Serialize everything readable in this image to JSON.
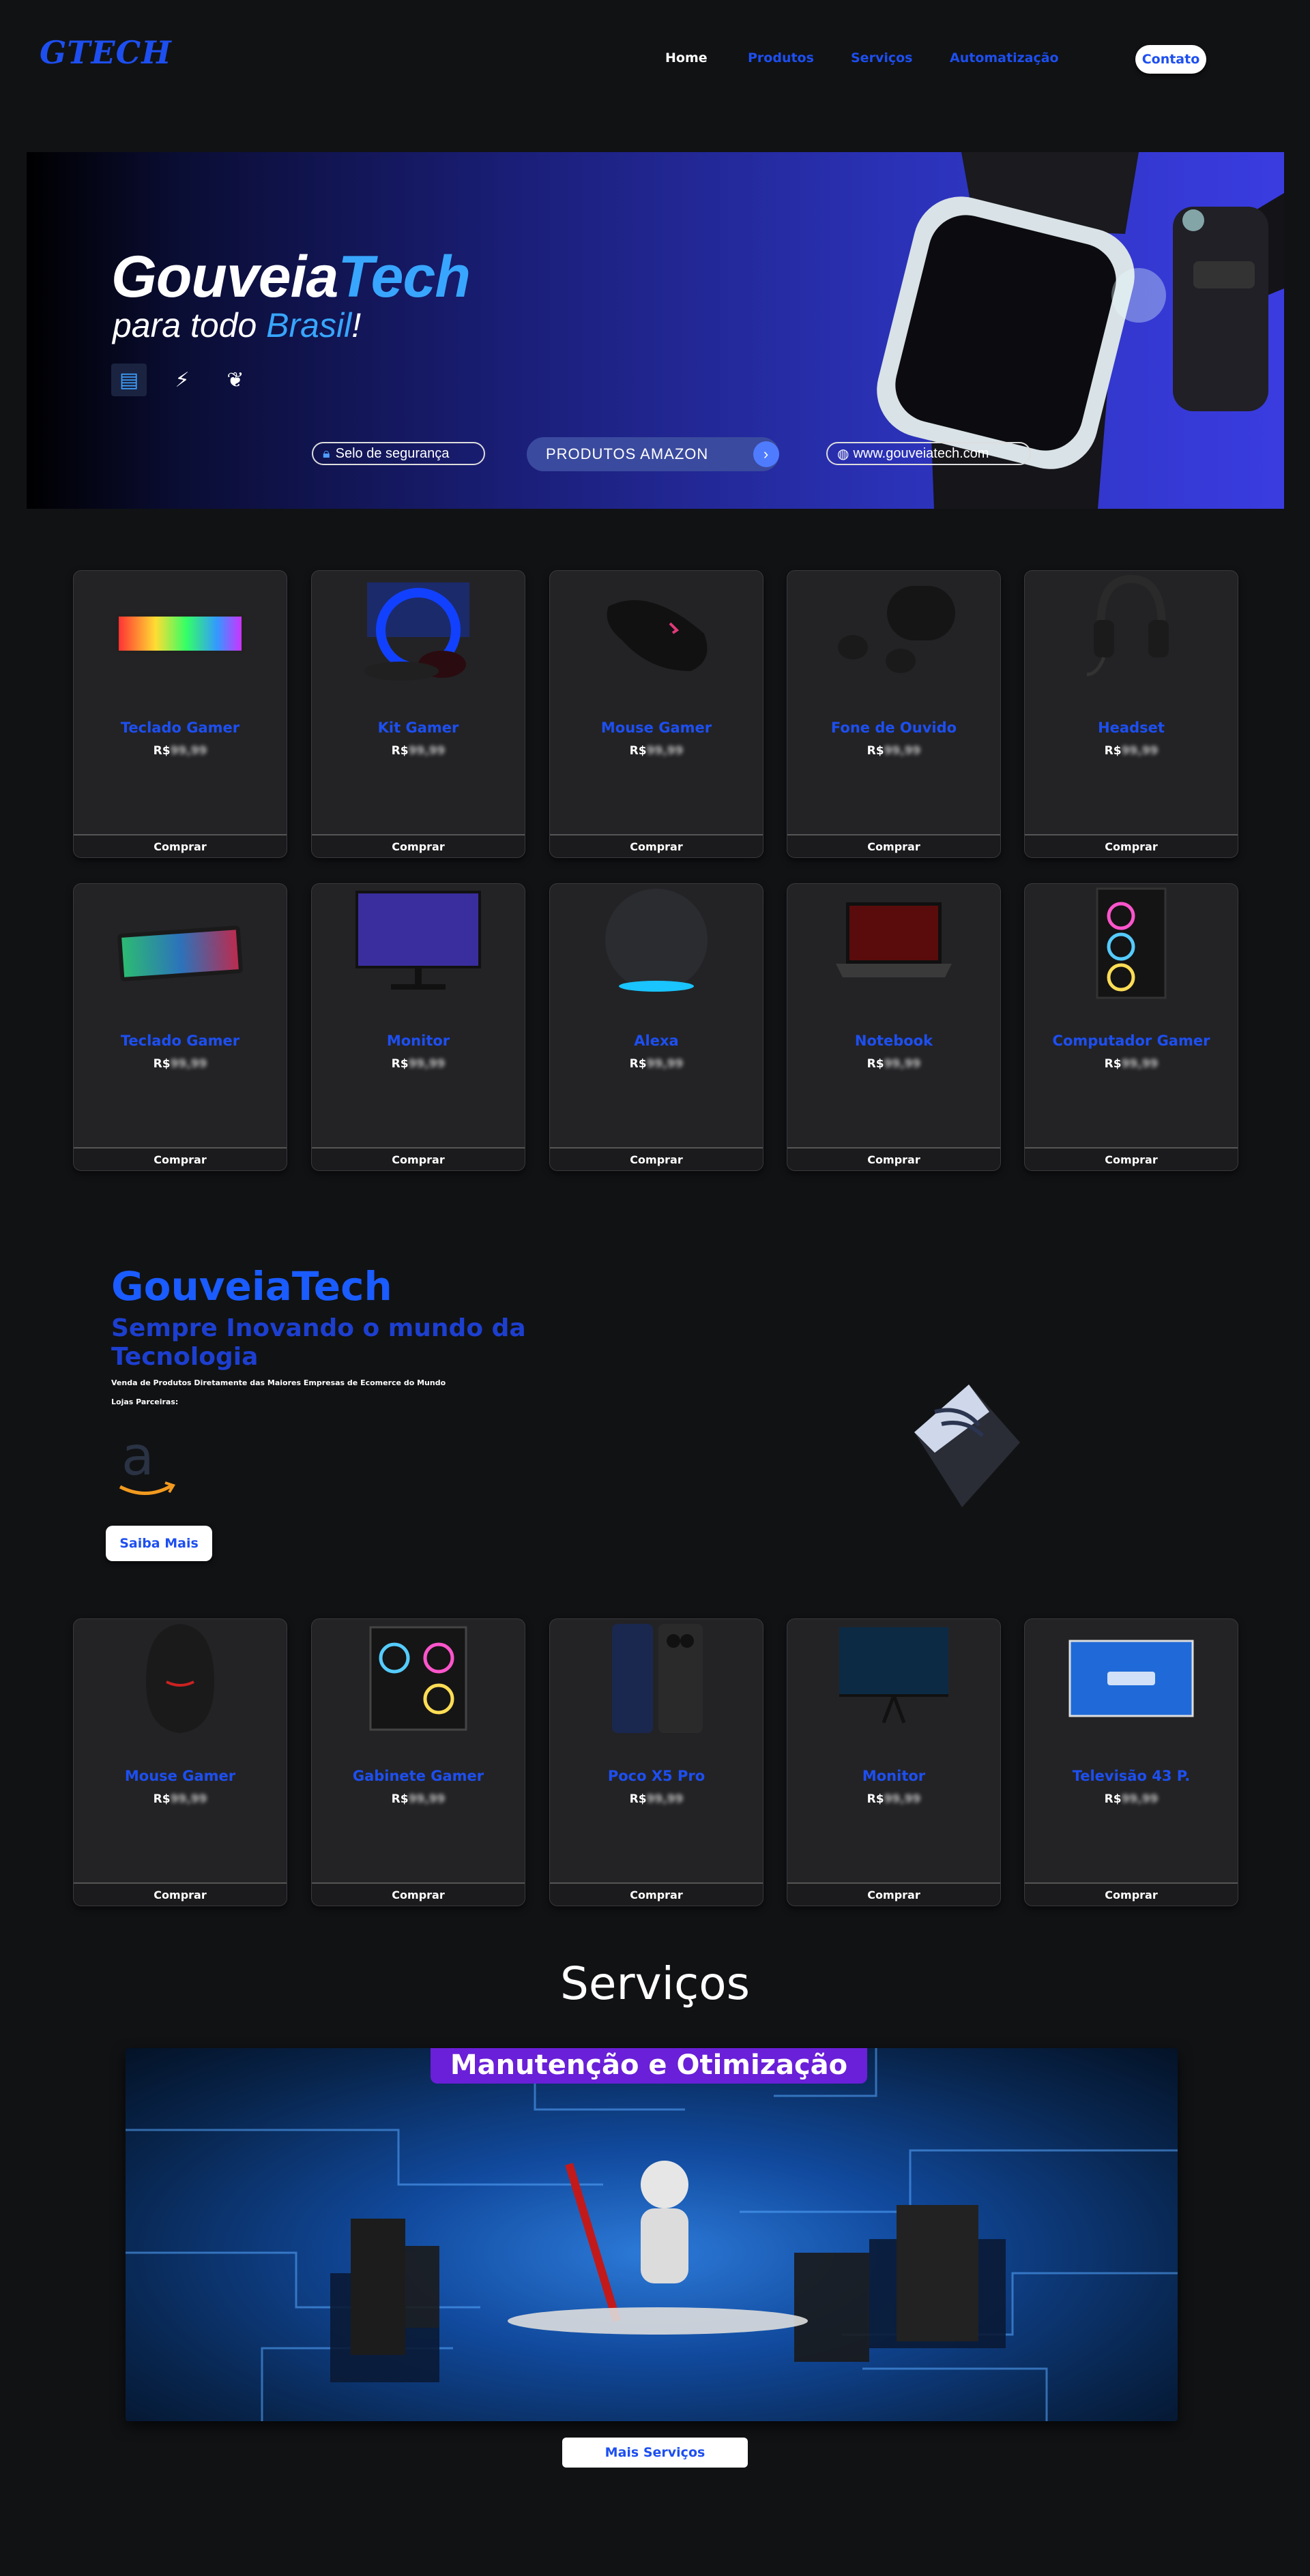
{
  "nav": {
    "logo": "GTECH",
    "links": [
      "Home",
      "Produtos",
      "Serviços",
      "Automatização"
    ],
    "contact": "Contato"
  },
  "banner": {
    "title_white": "Gouveia",
    "title_blue": "Tech",
    "subtitle_white": "para todo ",
    "subtitle_blue": "Brasil",
    "subtitle_end": "!",
    "pill_security": "Selo de segurança",
    "pill_amazon": "PRODUTOS AMAZON",
    "pill_site": "www.gouveiatech.com"
  },
  "products_row1": [
    {
      "name": "Teclado Gamer",
      "price_prefix": "R$",
      "price": "99,99"
    },
    {
      "name": "Kit Gamer",
      "price_prefix": "R$",
      "price": "99,99"
    },
    {
      "name": "Mouse Gamer",
      "price_prefix": "R$",
      "price": "99,99"
    },
    {
      "name": "Fone de Ouvido",
      "price_prefix": "R$",
      "price": "99,99"
    },
    {
      "name": "Headset",
      "price_prefix": "R$",
      "price": "99,99"
    }
  ],
  "products_row2": [
    {
      "name": "Teclado Gamer",
      "price_prefix": "R$",
      "price": "99,99"
    },
    {
      "name": "Monitor",
      "price_prefix": "R$",
      "price": "99,99"
    },
    {
      "name": "Alexa",
      "price_prefix": "R$",
      "price": "99,99"
    },
    {
      "name": "Notebook",
      "price_prefix": "R$",
      "price": "99,99"
    },
    {
      "name": "Computador Gamer",
      "price_prefix": "R$",
      "price": "99,99"
    }
  ],
  "products_row3": [
    {
      "name": "Mouse Gamer",
      "price_prefix": "R$",
      "price": "99,99"
    },
    {
      "name": "Gabinete Gamer",
      "price_prefix": "R$",
      "price": "99,99"
    },
    {
      "name": "Poco X5 Pro",
      "price_prefix": "R$",
      "price": "99,99"
    },
    {
      "name": "Monitor",
      "price_prefix": "R$",
      "price": "99,99"
    },
    {
      "name": "Televisão 43 P.",
      "price_prefix": "R$",
      "price": "99,99"
    }
  ],
  "buy_label": "Comprar",
  "about": {
    "title": "GouveiaTech",
    "subtitle": "Sempre Inovando o mundo da Tecnologia",
    "desc": "Venda de Produtos Diretamente das Maiores Empresas de Ecomerce do Mundo",
    "partners": "Lojas Parceiras:",
    "more": "Saiba Mais"
  },
  "services": {
    "title": "Serviços",
    "banner_label": "Manutenção e Otimização",
    "more": "Mais Serviços"
  },
  "colors": {
    "accent": "#1d4ff0",
    "background": "#111214",
    "card": "#232326",
    "purple": "#6a1fd8"
  }
}
